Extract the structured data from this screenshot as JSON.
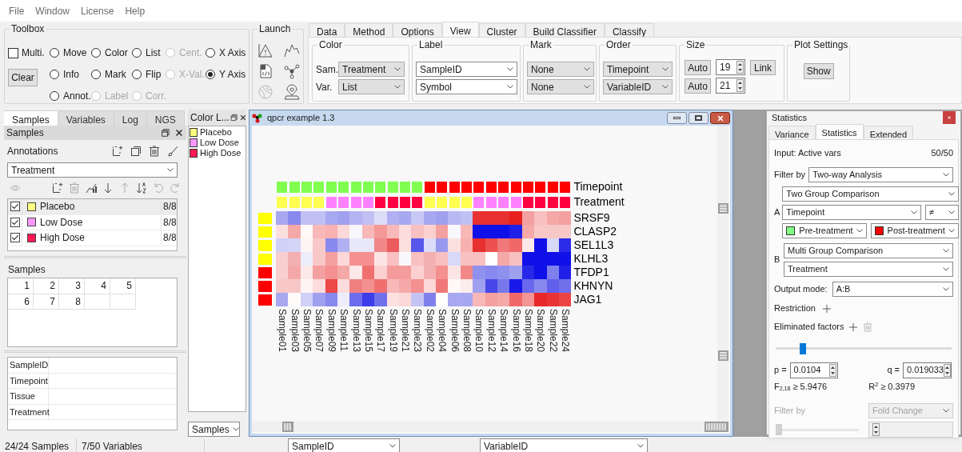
{
  "menu": [
    "File",
    "Window",
    "License",
    "Help"
  ],
  "toolbox": {
    "title": "Toolbox",
    "multi": {
      "label": "Multi.",
      "checked": false
    },
    "clear": "Clear",
    "rows": [
      [
        {
          "label": "Move",
          "selected": false,
          "disabled": false
        },
        {
          "label": "Color",
          "selected": false,
          "disabled": false
        },
        {
          "label": "List",
          "selected": false,
          "disabled": false
        },
        {
          "label": "Cent.",
          "selected": false,
          "disabled": true
        },
        {
          "label": "X Axis",
          "selected": false,
          "disabled": false
        }
      ],
      [
        {
          "label": "Info",
          "selected": false,
          "disabled": false
        },
        {
          "label": "Mark",
          "selected": false,
          "disabled": false
        },
        {
          "label": "Flip",
          "selected": false,
          "disabled": false
        },
        {
          "label": "X-Val.",
          "selected": false,
          "disabled": true
        },
        {
          "label": "Y Axis",
          "selected": true,
          "disabled": false
        }
      ],
      [
        {
          "label": "Annot.",
          "selected": false,
          "disabled": false
        },
        {
          "label": "Label",
          "selected": false,
          "disabled": true
        },
        {
          "label": "Corr.",
          "selected": false,
          "disabled": true
        }
      ]
    ]
  },
  "launch": {
    "title": "Launch",
    "icons": [
      {
        "kind": "triangle",
        "disabled": false
      },
      {
        "kind": "peaks",
        "disabled": false
      },
      {
        "kind": "code",
        "disabled": false
      },
      {
        "kind": "network",
        "disabled": false
      },
      {
        "kind": "globe",
        "disabled": true
      },
      {
        "kind": "pin",
        "disabled": false
      }
    ]
  },
  "tabs": [
    {
      "label": "Data",
      "selected": false
    },
    {
      "label": "Method",
      "selected": false
    },
    {
      "label": "Options",
      "selected": false
    },
    {
      "label": "View",
      "selected": true
    },
    {
      "label": "Cluster",
      "selected": false
    },
    {
      "label": "Build Classifier",
      "selected": false
    },
    {
      "label": "Classify",
      "selected": false
    }
  ],
  "view": {
    "color": {
      "title": "Color",
      "rows": [
        {
          "label": "Sam.",
          "value": "Treatment"
        },
        {
          "label": "Var.",
          "value": "List"
        }
      ]
    },
    "label": {
      "title": "Label",
      "values": [
        "SampleID",
        "Symbol"
      ]
    },
    "mark": {
      "title": "Mark",
      "values": [
        "None",
        "None"
      ]
    },
    "order": {
      "title": "Order",
      "values": [
        "Timepoint",
        "VariableID"
      ]
    },
    "size": {
      "title": "Size",
      "rows": [
        {
          "button": "Auto",
          "value": "19",
          "link": "Link"
        },
        {
          "button": "Auto",
          "value": "21"
        }
      ]
    },
    "plot_settings": {
      "title": "Plot Settings",
      "button": "Show"
    }
  },
  "left_dock": {
    "tabs": [
      {
        "label": "Samples",
        "selected": true
      },
      {
        "label": "Variables",
        "selected": false
      },
      {
        "label": "Log",
        "selected": false
      },
      {
        "label": "NGS",
        "selected": false
      }
    ],
    "title": "Samples",
    "annotations": "Annotations",
    "annotation_value": "Treatment",
    "groups": [
      {
        "label": "Placebo",
        "color": "#ffff80",
        "count": "8/8",
        "checked": true,
        "selected": true
      },
      {
        "label": "Low Dose",
        "color": "#ff99ff",
        "count": "8/8",
        "checked": true,
        "selected": false
      },
      {
        "label": "High Dose",
        "color": "#ff1a55",
        "count": "8/8",
        "checked": true,
        "selected": false
      }
    ],
    "samples_title": "Samples",
    "samples": [
      "1",
      "2",
      "3",
      "4",
      "5",
      "6",
      "7",
      "8"
    ],
    "properties": [
      "SampleID",
      "Timepoint",
      "Tissue",
      "Treatment"
    ]
  },
  "color_legend": {
    "title": "Color L...",
    "items": [
      {
        "label": "Placebo",
        "color": "#ffff80"
      },
      {
        "label": "Low Dose",
        "color": "#ff99ff"
      },
      {
        "label": "High Dose",
        "color": "#ff1a55"
      }
    ],
    "source": "Samples"
  },
  "plot": {
    "title": "qpcr example 1.3",
    "annotations": [
      {
        "label": "Timepoint",
        "cells": [
          {
            "color": "#80ff50"
          },
          {
            "color": "#80ff50"
          },
          {
            "color": "#80ff50"
          },
          {
            "color": "#80ff50"
          },
          {
            "color": "#80ff50"
          },
          {
            "color": "#80ff50"
          },
          {
            "color": "#80ff50"
          },
          {
            "color": "#80ff50"
          },
          {
            "color": "#80ff50"
          },
          {
            "color": "#80ff50"
          },
          {
            "color": "#80ff50"
          },
          {
            "color": "#80ff50"
          },
          {
            "color": "#ff0000"
          },
          {
            "color": "#ff0000"
          },
          {
            "color": "#ff0000"
          },
          {
            "color": "#ff0000"
          },
          {
            "color": "#ff0000"
          },
          {
            "color": "#ff0000"
          },
          {
            "color": "#ff0000"
          },
          {
            "color": "#ff0000"
          },
          {
            "color": "#ff0000"
          },
          {
            "color": "#ff0000"
          },
          {
            "color": "#ff0000"
          },
          {
            "color": "#ff0000"
          }
        ]
      },
      {
        "label": "Treatment",
        "cells": [
          {
            "color": "#ffff50"
          },
          {
            "color": "#ffff50"
          },
          {
            "color": "#ffff50"
          },
          {
            "color": "#ffff50"
          },
          {
            "color": "#ff80ff"
          },
          {
            "color": "#ff80ff"
          },
          {
            "color": "#ff80ff"
          },
          {
            "color": "#ff80ff"
          },
          {
            "color": "#ff0040"
          },
          {
            "color": "#ff0040"
          },
          {
            "color": "#ff0040"
          },
          {
            "color": "#ff0040"
          },
          {
            "color": "#ffff50"
          },
          {
            "color": "#ffff50"
          },
          {
            "color": "#ffff50"
          },
          {
            "color": "#ffff50"
          },
          {
            "color": "#ff80ff"
          },
          {
            "color": "#ff80ff"
          },
          {
            "color": "#ff80ff"
          },
          {
            "color": "#ff80ff"
          },
          {
            "color": "#ff0040"
          },
          {
            "color": "#ff0040"
          },
          {
            "color": "#ff0040"
          },
          {
            "color": "#ff0040"
          }
        ]
      }
    ],
    "rows": [
      {
        "label": "SRSF9",
        "color": "#ffff00",
        "cells": [
          {
            "color": "#a8a8f0"
          },
          {
            "color": "#8888ee"
          },
          {
            "color": "#c0c0f4"
          },
          {
            "color": "#c0c0f4"
          },
          {
            "color": "#a8a8f0"
          },
          {
            "color": "#a0a0ee"
          },
          {
            "color": "#b4b4f2"
          },
          {
            "color": "#c0c0f4"
          },
          {
            "color": "#dcdcf6"
          },
          {
            "color": "#b0b0f2"
          },
          {
            "color": "#a8a8f0"
          },
          {
            "color": "#c8c8f4"
          },
          {
            "color": "#a8a8f0"
          },
          {
            "color": "#a0a0ee"
          },
          {
            "color": "#b8b8f2"
          },
          {
            "color": "#c0c0f4"
          },
          {
            "color": "#e83030"
          },
          {
            "color": "#e83030"
          },
          {
            "color": "#e83030"
          },
          {
            "color": "#e82020"
          },
          {
            "color": "#f4a0a0"
          },
          {
            "color": "#f8c0c0"
          },
          {
            "color": "#f4a8a8"
          },
          {
            "color": "#f4a0a0"
          }
        ]
      },
      {
        "label": "CLASP2",
        "color": "#ffff00",
        "cells": [
          {
            "color": "#fce0e0"
          },
          {
            "color": "#f4a8a8"
          },
          {
            "color": "#fff8f8"
          },
          {
            "color": "#f8b8b8"
          },
          {
            "color": "#f8b0b0"
          },
          {
            "color": "#fcd8d8"
          },
          {
            "color": "#f8f8fc"
          },
          {
            "color": "#f8b8b8"
          },
          {
            "color": "#f49898"
          },
          {
            "color": "#f8b8b8"
          },
          {
            "color": "#fcdcdc"
          },
          {
            "color": "#f8c0c0"
          },
          {
            "color": "#fcd0d0"
          },
          {
            "color": "#f4a0a0"
          },
          {
            "color": "#f8f8fc"
          },
          {
            "color": "#f8b8b8"
          },
          {
            "color": "#1010e8"
          },
          {
            "color": "#1010e8"
          },
          {
            "color": "#1010e8"
          },
          {
            "color": "#2020e8"
          },
          {
            "color": "#f4a8a8"
          },
          {
            "color": "#f8c8c8"
          },
          {
            "color": "#f8c8c8"
          },
          {
            "color": "#f8c8c8"
          }
        ]
      },
      {
        "label": "SEL1L3",
        "color": "#ffff00",
        "cells": [
          {
            "color": "#d0d0f8"
          },
          {
            "color": "#d4d4f6"
          },
          {
            "color": "#fff4f4"
          },
          {
            "color": "#f8c8c8"
          },
          {
            "color": "#8888ee"
          },
          {
            "color": "#b0b0f2"
          },
          {
            "color": "#e8e8f8"
          },
          {
            "color": "#e8e8f8"
          },
          {
            "color": "#f08888"
          },
          {
            "color": "#ec5c5c"
          },
          {
            "color": "#fce0e0"
          },
          {
            "color": "#5858ec"
          },
          {
            "color": "#dcdcf8"
          },
          {
            "color": "#9898ee"
          },
          {
            "color": "#fce0e0"
          },
          {
            "color": "#f8b0b0"
          },
          {
            "color": "#e83030"
          },
          {
            "color": "#ec5050"
          },
          {
            "color": "#f07878"
          },
          {
            "color": "#f06868"
          },
          {
            "color": "#fce8e8"
          },
          {
            "color": "#1010e8"
          },
          {
            "color": "#d8d8f8"
          },
          {
            "color": "#2a2ae8"
          }
        ]
      },
      {
        "label": "KLHL3",
        "color": "#ffff00",
        "cells": [
          {
            "color": "#f8d0d0"
          },
          {
            "color": "#f4b0b0"
          },
          {
            "color": "#ececfa"
          },
          {
            "color": "#f8c8c8"
          },
          {
            "color": "#f4a0a0"
          },
          {
            "color": "#fcd8d8"
          },
          {
            "color": "#f49090"
          },
          {
            "color": "#f49090"
          },
          {
            "color": "#fce4e4"
          },
          {
            "color": "#f8c0c0"
          },
          {
            "color": "#f8f8fc"
          },
          {
            "color": "#f8c0c0"
          },
          {
            "color": "#f4b0b0"
          },
          {
            "color": "#f8c0c0"
          },
          {
            "color": "#d8d8f8"
          },
          {
            "color": "#f8c0c0"
          },
          {
            "color": "#f8c0c0"
          },
          {
            "color": "#ffffff"
          },
          {
            "color": "#f4a8a8"
          },
          {
            "color": "#f8c0c0"
          },
          {
            "color": "#1010e8"
          },
          {
            "color": "#1010e8"
          },
          {
            "color": "#1010e8"
          },
          {
            "color": "#1010e8"
          }
        ]
      },
      {
        "label": "TFDP1",
        "color": "#ff0000",
        "cells": [
          {
            "color": "#f8d0d0"
          },
          {
            "color": "#f4a8a8"
          },
          {
            "color": "#fce8e8"
          },
          {
            "color": "#f4a0a0"
          },
          {
            "color": "#f49090"
          },
          {
            "color": "#f4a8a8"
          },
          {
            "color": "#fce8e8"
          },
          {
            "color": "#f07070"
          },
          {
            "color": "#fcd0d0"
          },
          {
            "color": "#f49c9c"
          },
          {
            "color": "#f49c9c"
          },
          {
            "color": "#fcd0d0"
          },
          {
            "color": "#f4b0b0"
          },
          {
            "color": "#f49090"
          },
          {
            "color": "#fce4e4"
          },
          {
            "color": "#f08888"
          },
          {
            "color": "#9090ee"
          },
          {
            "color": "#8888ee"
          },
          {
            "color": "#9090ee"
          },
          {
            "color": "#a0a0f0"
          },
          {
            "color": "#2828e8"
          },
          {
            "color": "#1010e8"
          },
          {
            "color": "#8080ec"
          },
          {
            "color": "#2020e8"
          }
        ]
      },
      {
        "label": "KHNYN",
        "color": "#ff0000",
        "cells": [
          {
            "color": "#f8c8c8"
          },
          {
            "color": "#f8c8c8"
          },
          {
            "color": "#fff4f4"
          },
          {
            "color": "#fcdcdc"
          },
          {
            "color": "#ec4848"
          },
          {
            "color": "#fcdcdc"
          },
          {
            "color": "#f08080"
          },
          {
            "color": "#f49090"
          },
          {
            "color": "#f07070"
          },
          {
            "color": "#f8b8b8"
          },
          {
            "color": "#f4a8a8"
          },
          {
            "color": "#f49090"
          },
          {
            "color": "#fcd8d8"
          },
          {
            "color": "#f07878"
          },
          {
            "color": "#fff8f8"
          },
          {
            "color": "#fcecec"
          },
          {
            "color": "#a0a0f0"
          },
          {
            "color": "#4848e8"
          },
          {
            "color": "#7878ec"
          },
          {
            "color": "#1818e8"
          },
          {
            "color": "#6868ec"
          },
          {
            "color": "#8888ee"
          },
          {
            "color": "#6060ec"
          },
          {
            "color": "#7070ec"
          }
        ]
      },
      {
        "label": "JAG1",
        "color": "#ff0000",
        "cells": [
          {
            "color": "#a8a8f0"
          },
          {
            "color": "#fffafa"
          },
          {
            "color": "#d0d0f8"
          },
          {
            "color": "#a0a0f0"
          },
          {
            "color": "#8888ee"
          },
          {
            "color": "#ececfa"
          },
          {
            "color": "#6c6cec"
          },
          {
            "color": "#3c3ce8"
          },
          {
            "color": "#7070ec"
          },
          {
            "color": "#fce0e0"
          },
          {
            "color": "#fcd8d8"
          },
          {
            "color": "#c4c4f4"
          },
          {
            "color": "#8080ec"
          },
          {
            "color": "#ffffff"
          },
          {
            "color": "#a8a8f0"
          },
          {
            "color": "#a8a8f0"
          },
          {
            "color": "#f8b8b8"
          },
          {
            "color": "#f4a0a0"
          },
          {
            "color": "#f4a8a8"
          },
          {
            "color": "#f06868"
          },
          {
            "color": "#f49494"
          },
          {
            "color": "#e82828"
          },
          {
            "color": "#e83434"
          },
          {
            "color": "#ec4444"
          }
        ]
      }
    ],
    "columns": [
      "Sample01",
      "Sample03",
      "Sample05",
      "Sample07",
      "Sample09",
      "Sample11",
      "Sample13",
      "Sample15",
      "Sample17",
      "Sample19",
      "Sample21",
      "Sample23",
      "Sample02",
      "Sample04",
      "Sample06",
      "Sample08",
      "Sample10",
      "Sample12",
      "Sample14",
      "Sample16",
      "Sample18",
      "Sample20",
      "Sample22",
      "Sample24"
    ]
  },
  "statistics": {
    "title": "Statistics",
    "tabs": [
      {
        "label": "Variance",
        "selected": false
      },
      {
        "label": "Statistics",
        "selected": true
      },
      {
        "label": "Extended",
        "selected": false
      }
    ],
    "input_label": "Input: Active vars",
    "input_count": "50/50",
    "filter_label": "Filter by",
    "filter_value": "Two-way Analysis",
    "factor_a": {
      "label": "A",
      "comparison": "Two Group Comparison",
      "variable": "Timepoint",
      "operator": "≠",
      "groups": [
        {
          "label": "Pre-treatment",
          "color": "#80ff80"
        },
        {
          "label": "Post-treatment",
          "color": "#ff0000"
        }
      ]
    },
    "factor_b": {
      "label": "B",
      "comparison": "Multi Group Comparison",
      "variable": "Treatment"
    },
    "output_label": "Output mode:",
    "output_value": "A:B",
    "restriction": "Restriction",
    "eliminated": "Eliminated factors",
    "slider": {
      "level": 0.14
    },
    "p": {
      "label": "p =",
      "value": "0.0104"
    },
    "q": {
      "label": "q =",
      "value": "0.019033"
    },
    "f_stat": "F$_{2,18}$ ≥ 5.9476",
    "r2": "R$^{2}$ ≥ 0.3979",
    "filter2": {
      "label": "Filter by",
      "value": "Fold Change",
      "disabled": true
    },
    "slider2": {
      "level": 0,
      "disabled": true
    }
  },
  "status": [
    "24/24 Samples",
    "7/50 Variables"
  ],
  "bottom_selects": [
    "SampleID",
    "VariableID"
  ]
}
